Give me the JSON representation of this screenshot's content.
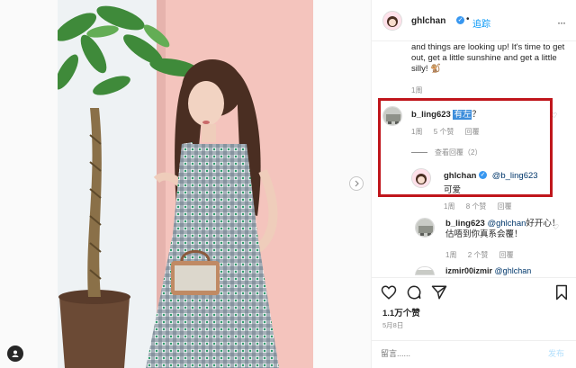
{
  "post": {
    "username": "ghlchan",
    "follow_label": "追踪",
    "dot": "•",
    "more_icon": "···",
    "caption": "and things are looking up! It's time to get out, get a little sunshine and get a little silly! 🐒",
    "caption_time": "1周"
  },
  "comments": [
    {
      "username": "b_ling623",
      "text_highlight": "有左",
      "text_suffix": "？",
      "time": "1周",
      "likes": "5 个赞",
      "reply_label": "回覆",
      "view_replies": "查看回覆（2）"
    }
  ],
  "replies": [
    {
      "username": "ghlchan",
      "mention": "@b_ling623",
      "text": "可爱",
      "time": "1周",
      "likes": "8 个赞",
      "reply_label": "回覆"
    },
    {
      "username": "b_ling623",
      "mention": "@ghlchan",
      "text": "好开心！估唔到你真系会覆！",
      "time": "1周",
      "likes": "2 个赞",
      "reply_label": "回覆"
    },
    {
      "username": "izmir00izmir",
      "mention": "@ghlchan"
    }
  ],
  "footer": {
    "likes_count": "1.1万个赞",
    "date": "5月8日",
    "comment_placeholder": "留言......",
    "post_label": "发布"
  },
  "icons": {
    "heart": "heart-icon",
    "comment": "comment-icon",
    "share": "share-icon",
    "bookmark": "bookmark-icon"
  },
  "colors": {
    "link_blue": "#0095f6",
    "highlight": "#3d8ddb",
    "red_box": "#c0161c",
    "verified": "#3897f0"
  }
}
